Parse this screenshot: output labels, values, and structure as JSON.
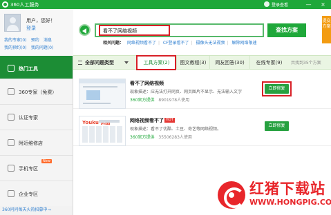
{
  "window": {
    "title": "360人工服务",
    "login_text": "登录查看",
    "controls": {
      "minimize": "—",
      "close": "×"
    }
  },
  "user": {
    "name": "用户，您好！",
    "login_link": "登录",
    "links": [
      "我的专家(0)",
      "预约",
      "消息",
      "我的预约(0)",
      "我的问题(0)"
    ]
  },
  "sidebar": {
    "items": [
      {
        "label": "热门工具",
        "icon": "home-icon",
        "active": true
      },
      {
        "label": "360专家（免费）",
        "icon": "expert-icon"
      },
      {
        "label": "认证专家",
        "icon": "certified-icon"
      },
      {
        "label": "附近维修店",
        "icon": "shop-icon"
      },
      {
        "label": "手机专区",
        "icon": "phone-icon",
        "badge": "New"
      },
      {
        "label": "企业专区",
        "icon": "enterprise-icon"
      }
    ],
    "footer": "360问问每天火热招募中→"
  },
  "search": {
    "value": "看不了网络视频",
    "button": "查找方案",
    "side_tab": "提交方案",
    "related_label": "相关问题：",
    "related": [
      "网络视频看不了",
      "CF登录看不了",
      "摄像头无法视频",
      "解除网络限速"
    ]
  },
  "tabs": {
    "category": "全部问题类型",
    "items": [
      "工具方案(2)",
      "图文教程(3)",
      "网友回答(30)",
      "在线专家(9)"
    ],
    "total": "共找到35个方案"
  },
  "results": [
    {
      "title": "看不了网络视频",
      "desc": "现象描述：应无法打开网页、网页图片不显示、无法输入文字",
      "provider": "360官方提供",
      "used": "8901978人使用",
      "button": "立即修复"
    },
    {
      "title": "网络视频看不了",
      "hot": "HOT",
      "desc": "现象描述：看不了优酷、土豆、奇艺等网络视频。",
      "provider": "360官方提供",
      "used": "35506283人使用",
      "button": "立即修复"
    }
  ],
  "thumb": {
    "brand": "Youku",
    "brand_cn": "优酷"
  },
  "watermark": {
    "cn": "红猪下载站",
    "url": "WWW.HONGPIG.COM"
  },
  "colors": {
    "brand_green": "#1fa83a",
    "highlight_red": "#d81f26",
    "link_blue": "#2f7fd0"
  }
}
